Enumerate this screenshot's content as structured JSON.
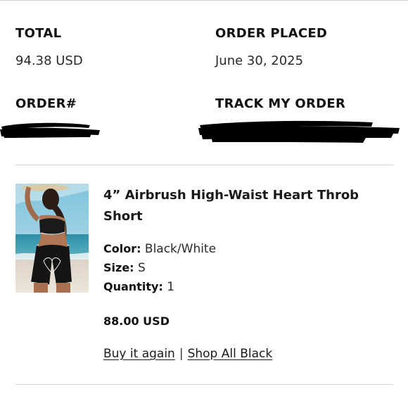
{
  "summary": {
    "total_label": "TOTAL",
    "total_value": "94.38 USD",
    "order_placed_label": "ORDER PLACED",
    "order_placed_value": "June 30, 2025",
    "order_number_label": "ORDER#",
    "track_label": "TRACK MY ORDER"
  },
  "product": {
    "title": "4” Airbrush High-Waist Heart Throb Short",
    "color_label": "Color:",
    "color_value": "Black/White",
    "size_label": "Size:",
    "size_value": "S",
    "quantity_label": "Quantity:",
    "quantity_value": "1",
    "price": "88.00 USD"
  },
  "actions": {
    "buy_again": "Buy it again",
    "separator": "|",
    "shop_all": "Shop All Black"
  }
}
